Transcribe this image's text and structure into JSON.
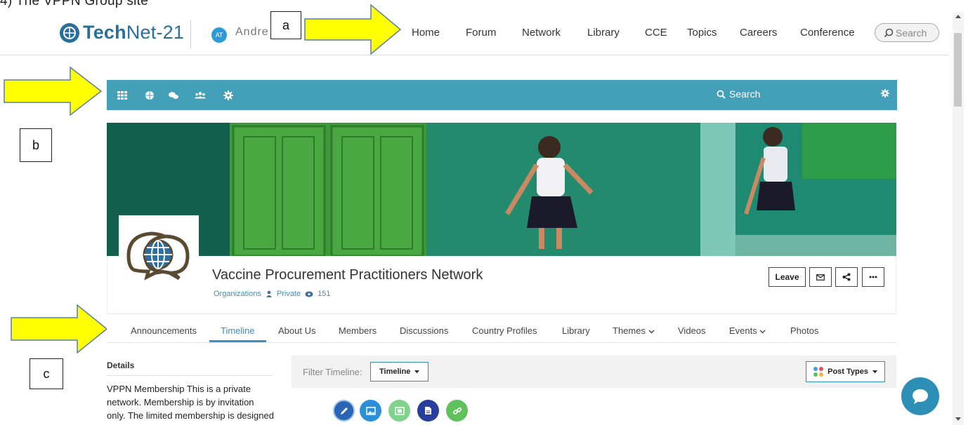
{
  "caption": "4)    The VPPN Group site",
  "topnav": {
    "logo_bold": "Tech",
    "logo_light": "Net-21",
    "avatar_initials": "AT",
    "username": "Andre",
    "links": [
      "Home",
      "Forum",
      "Network",
      "Library",
      "CCE",
      "Topics",
      "Careers",
      "Conference"
    ],
    "search_label": "Search"
  },
  "annotations": {
    "a": "a",
    "b": "b",
    "c": "c"
  },
  "group_bar": {
    "search_label": "Search"
  },
  "group": {
    "title": "Vaccine Procurement Practitioners Network",
    "category": "Organizations",
    "privacy": "Private",
    "views": "151"
  },
  "header_buttons": {
    "leave": "Leave"
  },
  "tabs": [
    "Announcements",
    "Timeline",
    "About Us",
    "Members",
    "Discussions",
    "Country Profiles",
    "Library",
    "Themes",
    "Videos",
    "Events",
    "Photos"
  ],
  "details": {
    "heading": "Details",
    "lines": [
      "VPPN Membership This is a private",
      "network. Membership is by invitation",
      "only. The limited membership is designed"
    ]
  },
  "filter": {
    "label": "Filter Timeline:",
    "selected": "Timeline",
    "post_types_label": "Post Types"
  },
  "colors": {
    "accent": "#43a0b8",
    "link": "#3a8fc2",
    "arrow": "#ffff00"
  }
}
